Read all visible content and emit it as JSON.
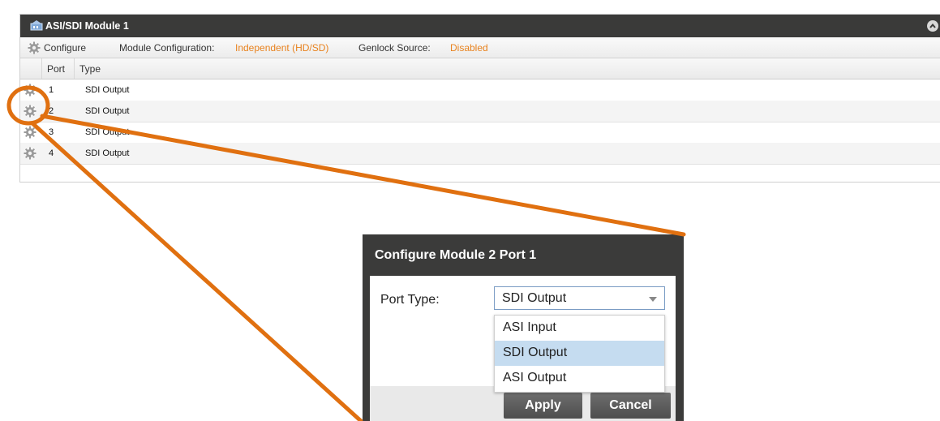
{
  "module": {
    "title": "ASI/SDI Module 1",
    "header_color": "#3a3a39",
    "toolbar": {
      "configure_label": "Configure",
      "module_config_label": "Module Configuration:",
      "module_config_value": "Independent (HD/SD)",
      "genlock_label": "Genlock Source:",
      "genlock_value": "Disabled",
      "value_color": "#e8821e"
    },
    "table": {
      "headers": [
        "Port",
        "Type"
      ],
      "rows": [
        {
          "port": "1",
          "type": "SDI Output"
        },
        {
          "port": "2",
          "type": "SDI Output"
        },
        {
          "port": "3",
          "type": "SDI Output"
        },
        {
          "port": "4",
          "type": "SDI Output"
        }
      ]
    }
  },
  "dialog": {
    "title": "Configure Module 2 Port 1",
    "port_type_label": "Port Type:",
    "port_type_value": "SDI Output",
    "options": [
      "ASI Input",
      "SDI Output",
      "ASI Output"
    ],
    "selected_option": "SDI Output",
    "apply_label": "Apply",
    "cancel_label": "Cancel"
  },
  "annotation": {
    "color": "#e07010",
    "shapes": [
      "circle-highlight",
      "callout-line"
    ]
  },
  "icons": [
    "module-icon",
    "collapse-icon",
    "gear-icon",
    "dropdown-caret-icon"
  ]
}
